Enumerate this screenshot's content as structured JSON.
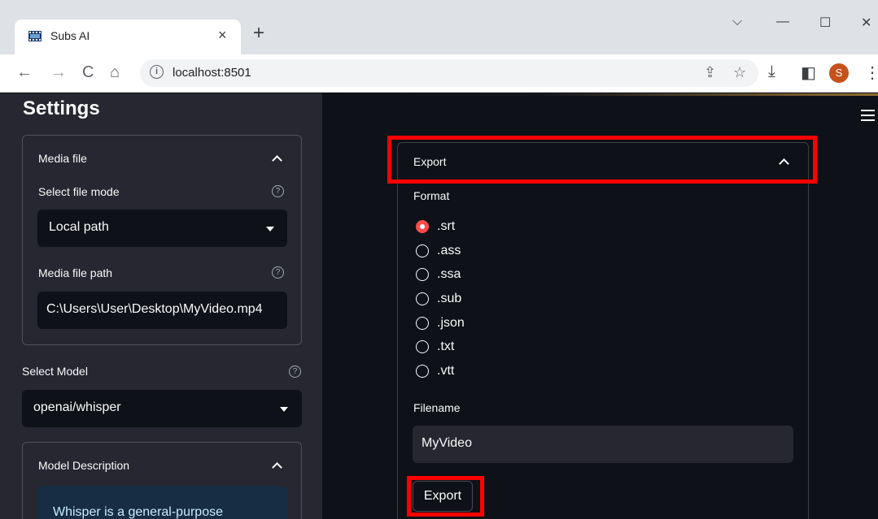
{
  "browser": {
    "tab_title": "Subs AI",
    "tab_close": "×",
    "new_tab": "+",
    "url": "localhost:8501",
    "profile_initial": "S",
    "window_controls": {
      "minimize": "—",
      "maximize": "☐",
      "close": "✕",
      "tab_search": "⌵"
    },
    "nav": {
      "back": "←",
      "forward": "→",
      "reload": "C",
      "home": "⌂"
    },
    "omnibox_icons": {
      "share": "⇪",
      "bookmark": "☆"
    },
    "tool_icons": {
      "download": "⤓",
      "sidebar": "◧",
      "menu": "⋮"
    }
  },
  "sidebar": {
    "title": "Settings",
    "media_file": {
      "header": "Media file",
      "select_file_mode_label": "Select file mode",
      "select_file_mode_value": "Local path",
      "media_file_path_label": "Media file path",
      "media_file_path_value": "C:\\Users\\User\\Desktop\\MyVideo.mp4"
    },
    "select_model_label": "Select Model",
    "select_model_value": "openai/whisper",
    "model_description": {
      "header": "Model Description",
      "text": "Whisper is a general-purpose"
    },
    "help_glyph": "?"
  },
  "main": {
    "export": {
      "header": "Export",
      "format_label": "Format",
      "formats": [
        ".srt",
        ".ass",
        ".ssa",
        ".sub",
        ".json",
        ".txt",
        ".vtt"
      ],
      "selected_format": ".srt",
      "filename_label": "Filename",
      "filename_value": "MyVideo",
      "button_label": "Export"
    }
  },
  "colors": {
    "accent": "#ff4b4b",
    "highlight": "#ff0000",
    "sidebar_bg": "#262730",
    "main_bg": "#0e1117"
  }
}
